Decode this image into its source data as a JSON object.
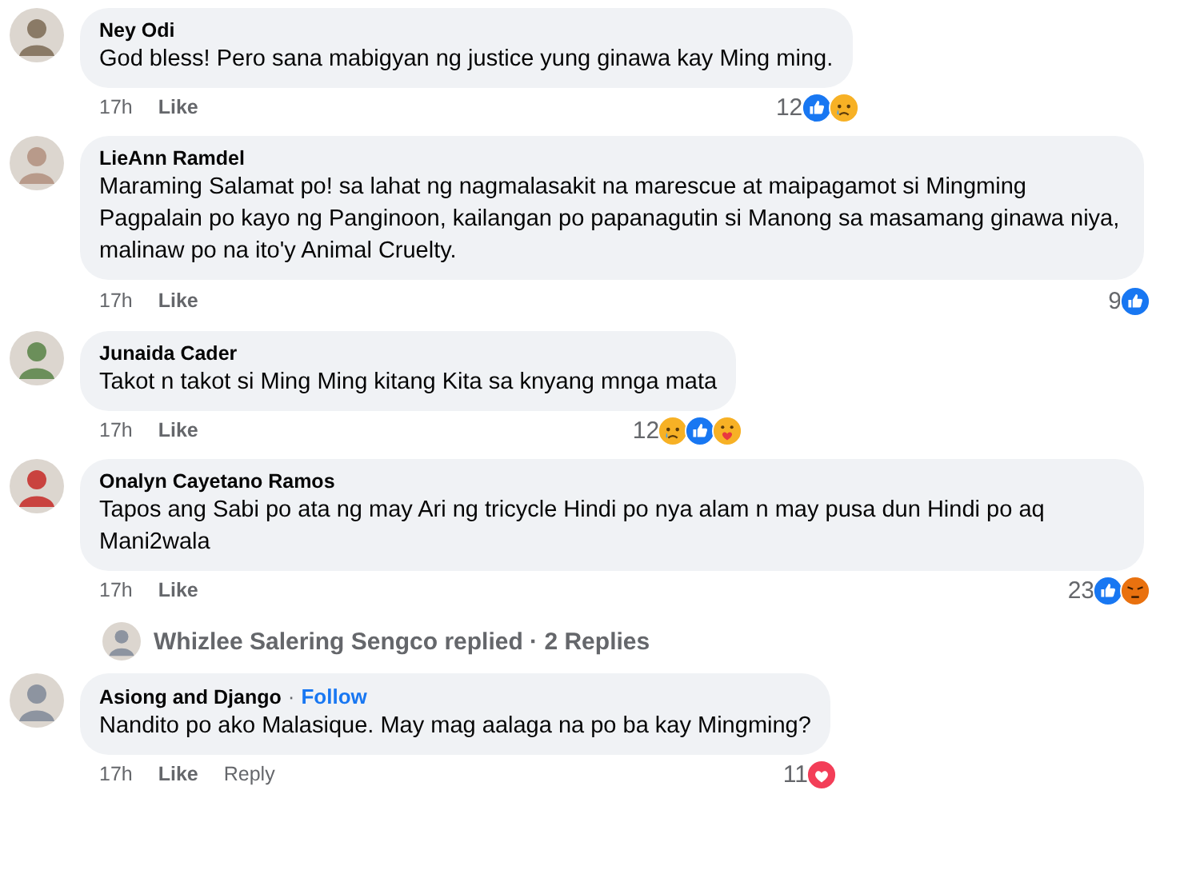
{
  "comments": [
    {
      "author": "Ney Odi",
      "text": "God bless! Pero sana mabigyan ng justice yung ginawa kay Ming ming.",
      "time": "17h",
      "actions": [
        "Like"
      ],
      "reaction_count": "12",
      "reactions": [
        {
          "kind": "like"
        },
        {
          "kind": "sad"
        }
      ]
    },
    {
      "author": "LieAnn Ramdel",
      "text": "Maraming Salamat po! sa lahat ng nagmalasakit na marescue at maipagamot si Mingming Pagpalain po kayo ng Panginoon, kailangan po papanagutin si Manong sa masamang ginawa niya, malinaw po na ito'y Animal Cruelty.",
      "time": "17h",
      "actions": [
        "Like"
      ],
      "reaction_count": "9",
      "reactions": [
        {
          "kind": "like"
        }
      ]
    },
    {
      "author": "Junaida Cader",
      "text": "Takot n takot si Ming Ming kitang Kita sa knyang mnga mata",
      "time": "17h",
      "actions": [
        "Like"
      ],
      "reaction_count": "12",
      "reactions": [
        {
          "kind": "sad"
        },
        {
          "kind": "like"
        },
        {
          "kind": "care"
        }
      ]
    },
    {
      "author": "Onalyn Cayetano Ramos",
      "text": "Tapos ang Sabi po ata ng may Ari ng tricycle Hindi po nya alam n may pusa dun Hindi po aq Mani2wala",
      "time": "17h",
      "actions": [
        "Like"
      ],
      "reaction_count": "23",
      "reactions": [
        {
          "kind": "like"
        },
        {
          "kind": "angry"
        }
      ],
      "replies": "Whizlee Salering Sengco replied · 2 Replies"
    },
    {
      "author": "Asiong and Django",
      "separator": "·",
      "follow": "Follow",
      "text": "Nandito po ako Malasique. May mag aalaga na po ba kay Mingming?",
      "time": "17h",
      "actions": [
        "Like",
        "Reply"
      ],
      "reaction_count": "11",
      "reactions": [
        {
          "kind": "love"
        }
      ]
    }
  ]
}
